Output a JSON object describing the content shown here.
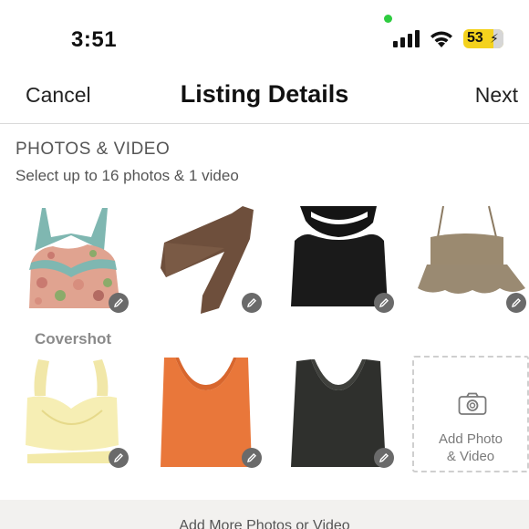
{
  "status_bar": {
    "time": "3:51",
    "battery": "53",
    "battery_color": "#f4d21d",
    "dot_color": "#2ecc40"
  },
  "nav": {
    "cancel": "Cancel",
    "title": "Listing Details",
    "next": "Next"
  },
  "photos": {
    "section_title": "PHOTOS & VIDEO",
    "subtitle": "Select up to 16 photos & 1 video",
    "covershot_label": "Covershot",
    "add_label_line1": "Add Photo",
    "add_label_line2": "& Video",
    "items": [
      {
        "name": "floral lace cami",
        "icon": "floral-cami-image"
      },
      {
        "name": "brown one-shoulder top",
        "icon": "brown-top-image"
      },
      {
        "name": "black halter top",
        "icon": "black-halter-image"
      },
      {
        "name": "taupe peplum cami",
        "icon": "taupe-peplum-image"
      },
      {
        "name": "yellow ruffle bralette top",
        "icon": "yellow-top-image"
      },
      {
        "name": "orange ribbed tank",
        "icon": "orange-tank-image"
      },
      {
        "name": "charcoal ribbed tank",
        "icon": "charcoal-tank-image"
      }
    ]
  },
  "bottom_bar": {
    "text": "Add More Photos or Video"
  }
}
